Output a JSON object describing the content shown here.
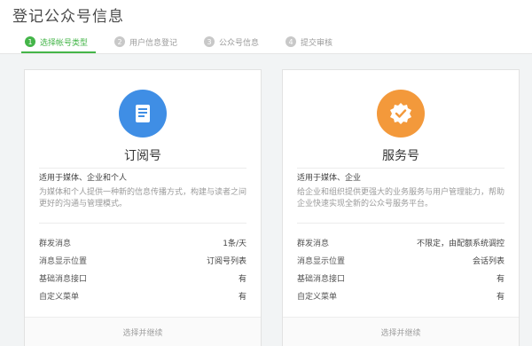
{
  "page": {
    "title": "登记公众号信息"
  },
  "steps": [
    {
      "num": "1",
      "label": "选择帐号类型"
    },
    {
      "num": "2",
      "label": "用户信息登记"
    },
    {
      "num": "3",
      "label": "公众号信息"
    },
    {
      "num": "4",
      "label": "提交审核"
    }
  ],
  "active_step": 1,
  "colors": {
    "accent": "#44b549",
    "subscription_icon": "#3f8ee5",
    "service_icon": "#f3993b",
    "stage_bg": "#f2f4f5"
  },
  "cards": [
    {
      "icon": "document-icon",
      "title": "订阅号",
      "subtitle": "适用于媒体、企业和个人",
      "description": "为媒体和个人提供一种新的信息传播方式，构建与读者之间更好的沟通与管理模式。",
      "features": [
        {
          "label": "群发消息",
          "value": "1条/天"
        },
        {
          "label": "消息显示位置",
          "value": "订阅号列表"
        },
        {
          "label": "基础消息接口",
          "value": "有"
        },
        {
          "label": "自定义菜单",
          "value": "有"
        }
      ],
      "footer": "选择并继续"
    },
    {
      "icon": "badge-check-icon",
      "title": "服务号",
      "subtitle": "适用于媒体、企业",
      "description": "给企业和组织提供更强大的业务服务与用户管理能力，帮助企业快速实现全新的公众号服务平台。",
      "features": [
        {
          "label": "群发消息",
          "value": "不限定，由配额系统调控"
        },
        {
          "label": "消息显示位置",
          "value": "会话列表"
        },
        {
          "label": "基础消息接口",
          "value": "有"
        },
        {
          "label": "自定义菜单",
          "value": "有"
        }
      ],
      "footer": "选择并继续"
    }
  ]
}
